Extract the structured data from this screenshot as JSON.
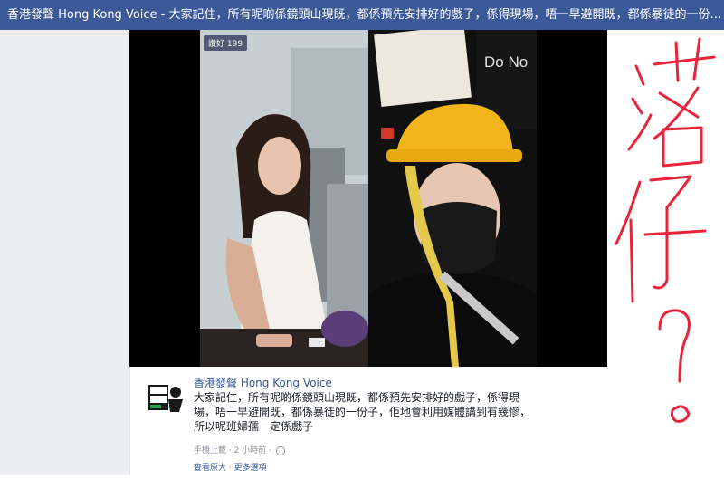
{
  "title_bar": {
    "text": "香港發聲 Hong Kong Voice - 大家記住，所有呢啲係鏡頭山現既，都係預先安排好的戲子，係得現場，唔一早避開既，都係暴徒的一份子，..."
  },
  "photo": {
    "like_badge": "讚好 199",
    "sign_text": "Do No"
  },
  "post": {
    "page_name": "香港發聲 Hong Kong Voice",
    "text": "大家記住，所有呢啲係鏡頭山現既，都係預先安排好的戲子，係得現場，唔一早避開既，都係暴徒的一份子，佢地會利用媒體講到有幾慘，所以呢班婦孺一定係戲子",
    "meta": "手機上載 · 2 小時前 ·",
    "globe_icon": "globe-icon",
    "view_full": "查看原大",
    "more_options": "更多選項",
    "avatar_logo": "香港發聲"
  },
  "handwriting": {
    "text": "落仔?",
    "color": "#e8233a"
  },
  "colors": {
    "facebook_blue": "#3b5998",
    "link_blue": "#365899",
    "margin_gray": "#eceef2"
  }
}
